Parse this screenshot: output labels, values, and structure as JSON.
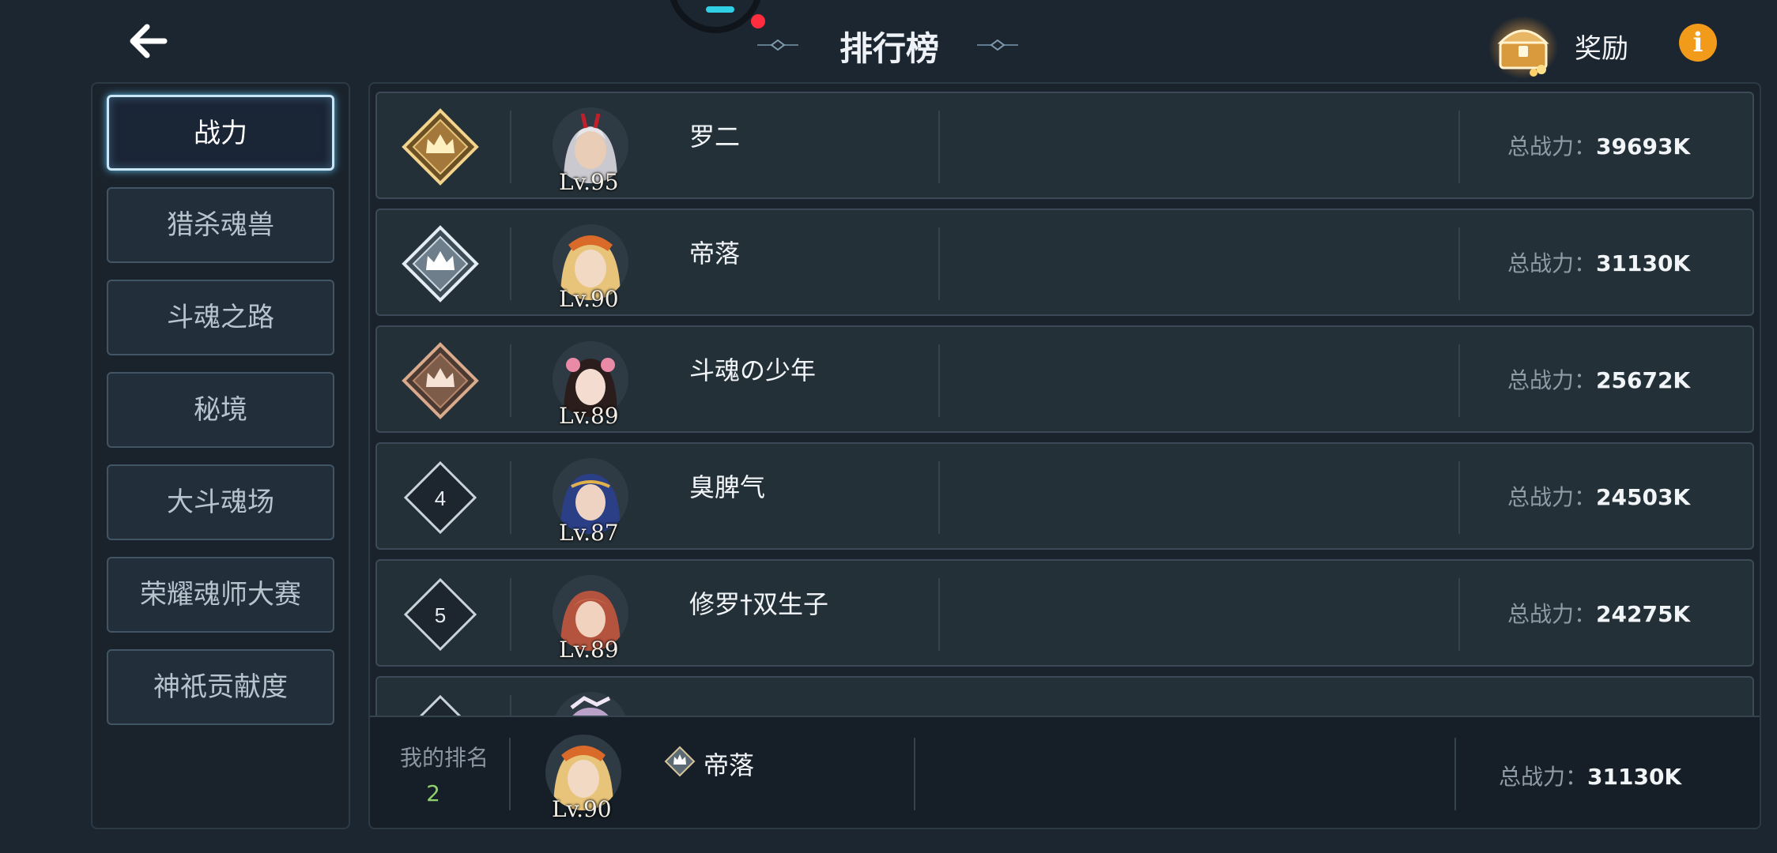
{
  "header": {
    "title": "排行榜",
    "reward_label": "奖励",
    "info_symbol": "i"
  },
  "sidebar": {
    "items": [
      {
        "label": "战力",
        "active": true
      },
      {
        "label": "猎杀魂兽",
        "active": false
      },
      {
        "label": "斗魂之路",
        "active": false
      },
      {
        "label": "秘境",
        "active": false
      },
      {
        "label": "大斗魂场",
        "active": false
      },
      {
        "label": "荣耀魂师大赛",
        "active": false
      },
      {
        "label": "神祇贡献度",
        "active": false
      }
    ]
  },
  "leaderboard": {
    "power_label": "总战力：",
    "rows": [
      {
        "rank": "1",
        "name": "罗二",
        "level": "Lv.95",
        "power": "39693K"
      },
      {
        "rank": "2",
        "name": "帝落",
        "level": "Lv.90",
        "power": "31130K"
      },
      {
        "rank": "3",
        "name": "斗魂の少年",
        "level": "Lv.89",
        "power": "25672K"
      },
      {
        "rank": "4",
        "name": "臭脾气",
        "level": "Lv.87",
        "power": "24503K"
      },
      {
        "rank": "5",
        "name": "修罗†双生子",
        "level": "Lv.89",
        "power": "24275K"
      }
    ]
  },
  "my_rank": {
    "label": "我的排名",
    "rank": "2",
    "name": "帝落",
    "level": "Lv.90",
    "power_label": "总战力：",
    "power": "31130K"
  },
  "colors": {
    "accent_active": "#c9e6f7",
    "gold": "#d8b46a",
    "silver": "#cfdbe3",
    "bronze": "#b8866a",
    "rank_number_green": "#8fd16a",
    "info_orange": "#f29a1a"
  }
}
